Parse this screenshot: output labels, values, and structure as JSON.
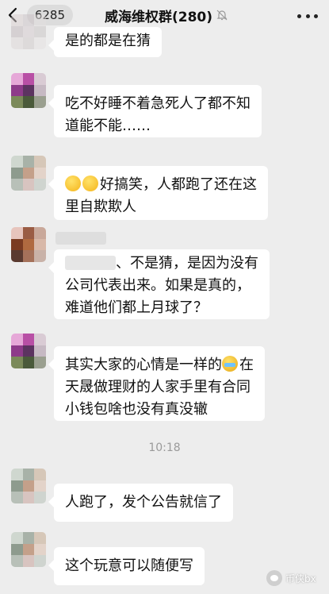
{
  "header": {
    "unread_count": "6285",
    "title": "威海维权群(280)"
  },
  "messages": [
    {
      "line1": "是的都是在猜",
      "line2": ""
    },
    {
      "line1": "吃不好睡不着急死人了都不知",
      "line2": "道能不能……"
    },
    {
      "emoji": "thinking-face-icon",
      "line1": "好搞笑，人都跑了还在这",
      "line2": "里自欺欺人"
    },
    {
      "line1": "、不是猜，是因为没有",
      "line2": "公司代表出来。如果是真的，",
      "line3": "难道他们都上月球了？"
    },
    {
      "line1": "其实大家的心情是一样的",
      "emoji": "crying-face-icon",
      "line1_tail": "在",
      "line2": "天晟做理财的人家手里有合同",
      "line3": "小钱包啥也没有真没辙"
    },
    {
      "line1": "人跑了，发个公告就信了"
    },
    {
      "line1": "这个玩意可以随便写"
    }
  ],
  "timestamp": "10:18",
  "watermark": {
    "text": "币侠bx",
    "icon": "wechat-logo-icon"
  },
  "colors": {
    "background": "#ededed",
    "bubble": "#ffffff",
    "timestamp": "#9a9a9a"
  }
}
